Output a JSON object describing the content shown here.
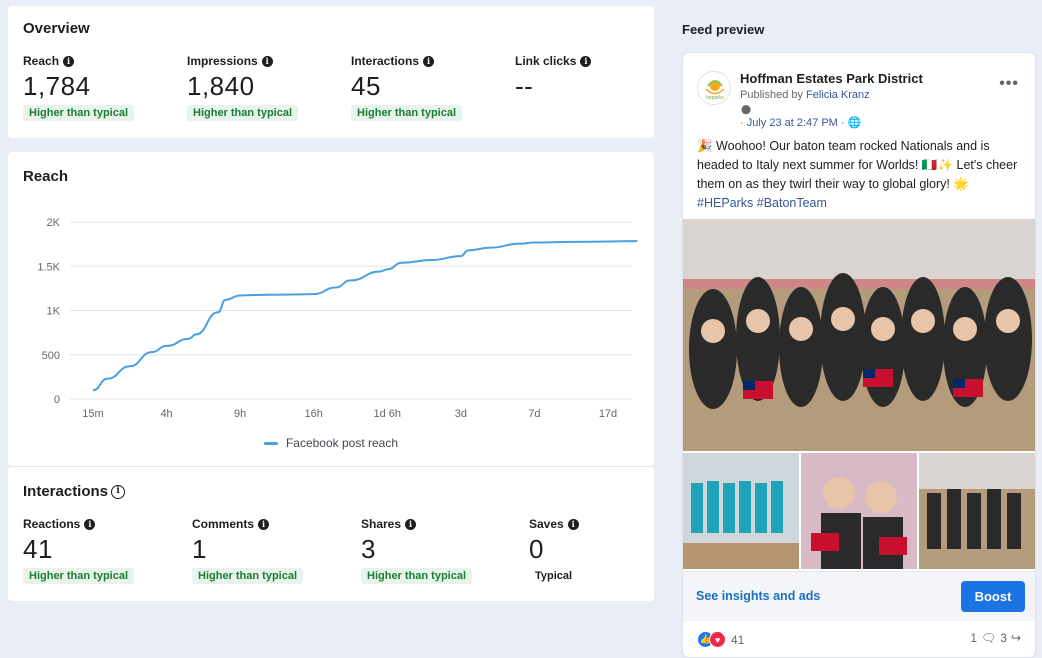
{
  "overview": {
    "title": "Overview",
    "metrics": [
      {
        "label": "Reach",
        "value": "1,784",
        "badge": "Higher than typical"
      },
      {
        "label": "Impressions",
        "value": "1,840",
        "badge": "Higher than typical"
      },
      {
        "label": "Interactions",
        "value": "45",
        "badge": "Higher than typical"
      },
      {
        "label": "Link clicks",
        "value": "--",
        "badge": ""
      }
    ]
  },
  "reach_chart": {
    "title": "Reach",
    "legend": "Facebook post reach"
  },
  "chart_data": {
    "type": "line",
    "title": "Reach",
    "x": [
      "15m",
      "4h",
      "9h",
      "16h",
      "1d 6h",
      "3d",
      "7d",
      "17d"
    ],
    "ylim": [
      0,
      2000
    ],
    "yticks": [
      "0",
      "500",
      "1K",
      "1.5K",
      "2K"
    ],
    "grid": true,
    "legend_position": "bottom-center",
    "series": [
      {
        "name": "Facebook post reach",
        "color": "#4a9fe0",
        "points": [
          [
            0.0,
            100
          ],
          [
            0.2,
            230
          ],
          [
            0.5,
            370
          ],
          [
            0.8,
            530
          ],
          [
            1.0,
            600
          ],
          [
            1.3,
            680
          ],
          [
            1.4,
            730
          ],
          [
            1.7,
            980
          ],
          [
            1.8,
            1120
          ],
          [
            2.0,
            1170
          ],
          [
            2.2,
            1175
          ],
          [
            2.6,
            1180
          ],
          [
            3.0,
            1185
          ],
          [
            3.3,
            1260
          ],
          [
            3.5,
            1340
          ],
          [
            3.9,
            1440
          ],
          [
            4.0,
            1465
          ],
          [
            4.2,
            1540
          ],
          [
            4.6,
            1570
          ],
          [
            5.0,
            1615
          ],
          [
            5.1,
            1680
          ],
          [
            5.4,
            1710
          ],
          [
            5.8,
            1755
          ],
          [
            6.0,
            1768
          ],
          [
            6.5,
            1775
          ],
          [
            7.0,
            1780
          ],
          [
            7.4,
            1784
          ]
        ]
      }
    ]
  },
  "interactions": {
    "title": "Interactions",
    "metrics": [
      {
        "label": "Reactions",
        "value": "41",
        "badge": "Higher than typical"
      },
      {
        "label": "Comments",
        "value": "1",
        "badge": "Higher than typical"
      },
      {
        "label": "Shares",
        "value": "3",
        "badge": "Higher than typical"
      },
      {
        "label": "Saves",
        "value": "0",
        "badge": "Typical"
      }
    ]
  },
  "feed": {
    "title": "Feed preview",
    "page_name": "Hoffman Estates Park District",
    "published_prefix": "Published by ",
    "published_by": "Felicia Kranz",
    "date": "July 23 at 2:47 PM",
    "menu": "•••",
    "text_emoji_1": "🎉",
    "text_main": " Woohoo! Our baton team rocked Nationals and is headed to Italy next summer for Worlds! ",
    "text_emoji_2": "🇮🇹✨",
    "text_main_2": " Let's cheer them on as they twirl their way to global glory! ",
    "text_emoji_3": "🌟",
    "hashtags": " #HEParks #BatonTeam",
    "logo_text": "heparks",
    "insights_link": "See insights and ads",
    "boost_label": "Boost",
    "reaction_count": "41",
    "comments_count": "1",
    "shares_count": "3"
  },
  "colors": {
    "accent_blue": "#1b74e4",
    "badge_green": "#1e7b34",
    "badge_bg": "#e6f4ea",
    "chart_line": "#4a9fe0"
  }
}
